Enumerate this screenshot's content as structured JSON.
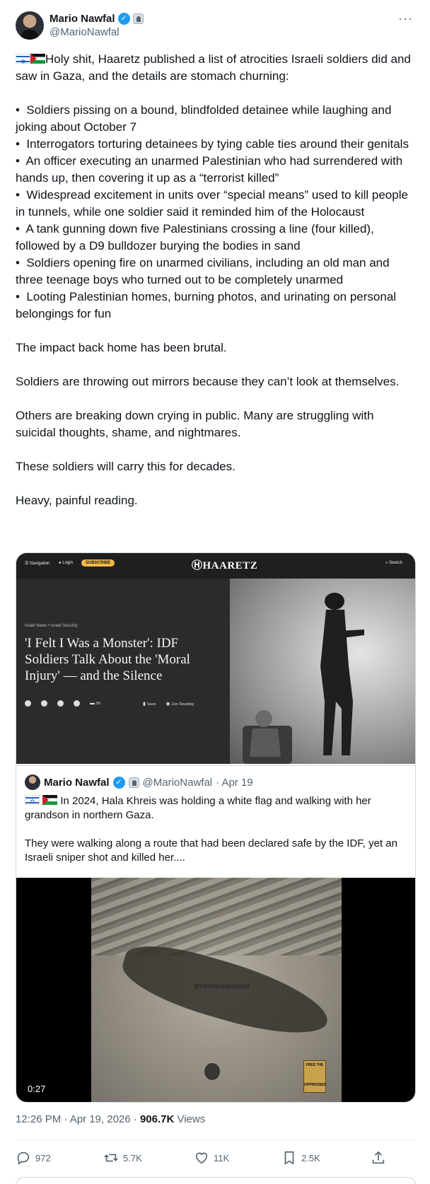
{
  "author": {
    "name": "Mario Nawfal",
    "handle": "@MarioNawfal"
  },
  "tweet": {
    "intro": "Holy shit, Haaretz published a list of atrocities Israeli soldiers did and saw in Gaza, and the details are stomach churning:",
    "bullets": [
      "Soldiers pissing on a bound, blindfolded detainee while laughing and joking about October 7",
      "Interrogators torturing detainees by tying cable ties around their genitals",
      "An officer executing an unarmed Palestinian who had surrendered with hands up, then covering it up as a “terrorist killed”",
      "Widespread excitement in units over “special means” used to kill people in tunnels, while one soldier said it reminded him of the Holocaust",
      "A tank gunning down five Palestinians crossing a line (four killed), followed by a D9 bulldozer burying the bodies in sand",
      "Soldiers opening fire on unarmed civilians, including an old man and three teenage boys who turned out to be completely unarmed",
      "Looting Palestinian homes, burning photos, and urinating on personal belongings for fun"
    ],
    "para1": "The impact back home has been brutal.",
    "para2": "Soldiers are throwing out mirrors because they can’t look at themselves.",
    "para3": "Others are breaking down crying in public. Many are struggling with suicidal thoughts, shame, and nightmares.",
    "para4": "These soldiers will carry this for decades.",
    "para5": "Heavy, painful reading."
  },
  "article": {
    "nav_label": "Navigation",
    "login_label": "Login",
    "subscribe_label": "SUBSCRIBE",
    "logo": "HAARETZ",
    "search_label": "Search",
    "kicker": "Israel News • Israel Security",
    "headline": "'I Felt I Was a Monster': IDF Soldiers Talk About the 'Moral Injury' — and the Silence",
    "comment_count": "56",
    "save_label": "Save",
    "zen_label": "Zen Reading"
  },
  "quote": {
    "name": "Mario Nawfal",
    "handle": "@MarioNawfal",
    "date": "· Apr 19",
    "line1": "In 2024, Hala Khreis was holding a white flag and walking with her grandson in northern Gaza.",
    "line2": "They were walking along a route that had been declared safe by the IDF, yet an Israeli sniper shot and killed her....",
    "video_watermark": "@freetheoppressed",
    "poster_text_top": "FREE THE",
    "poster_text_bottom": "OPPRESSED",
    "duration": "0:27"
  },
  "meta": {
    "time": "12:26 PM · Apr 19, 2026 · ",
    "views_count": "906.7K",
    "views_label": " Views"
  },
  "actions": {
    "replies": "972",
    "reposts": "5.7K",
    "likes": "11K",
    "bookmarks": "2.5K"
  },
  "colors": {
    "verified": "#1d9bf0",
    "subscribe": "#f3b84b",
    "muted": "#536471"
  }
}
